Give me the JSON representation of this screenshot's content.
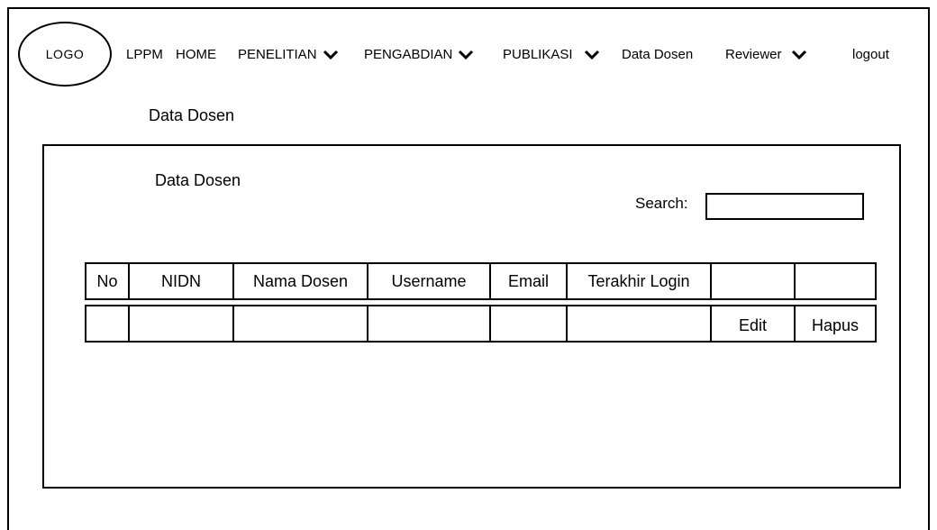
{
  "header": {
    "logo": "LOGO",
    "nav": [
      {
        "label": "LPPM",
        "dropdown": false
      },
      {
        "label": "HOME",
        "dropdown": false
      },
      {
        "label": "PENELITIAN",
        "dropdown": true
      },
      {
        "label": "PENGABDIAN",
        "dropdown": true
      },
      {
        "label": "PUBLIKASI",
        "dropdown": true
      },
      {
        "label": "Data Dosen",
        "dropdown": false
      },
      {
        "label": "Reviewer",
        "dropdown": true
      },
      {
        "label": "logout",
        "dropdown": false
      }
    ]
  },
  "page": {
    "title": "Data Dosen"
  },
  "panel": {
    "title": "Data Dosen",
    "search": {
      "label": "Search:",
      "value": ""
    }
  },
  "table": {
    "headers": [
      "No",
      "NIDN",
      "Nama Dosen",
      "Username",
      "Email",
      "Terakhir Login",
      "",
      ""
    ],
    "rows": [
      [
        "",
        "",
        "",
        "",
        "",
        "",
        "Edit",
        "Hapus"
      ]
    ]
  },
  "icons": {
    "dropdown": "chevron-down-icon"
  }
}
